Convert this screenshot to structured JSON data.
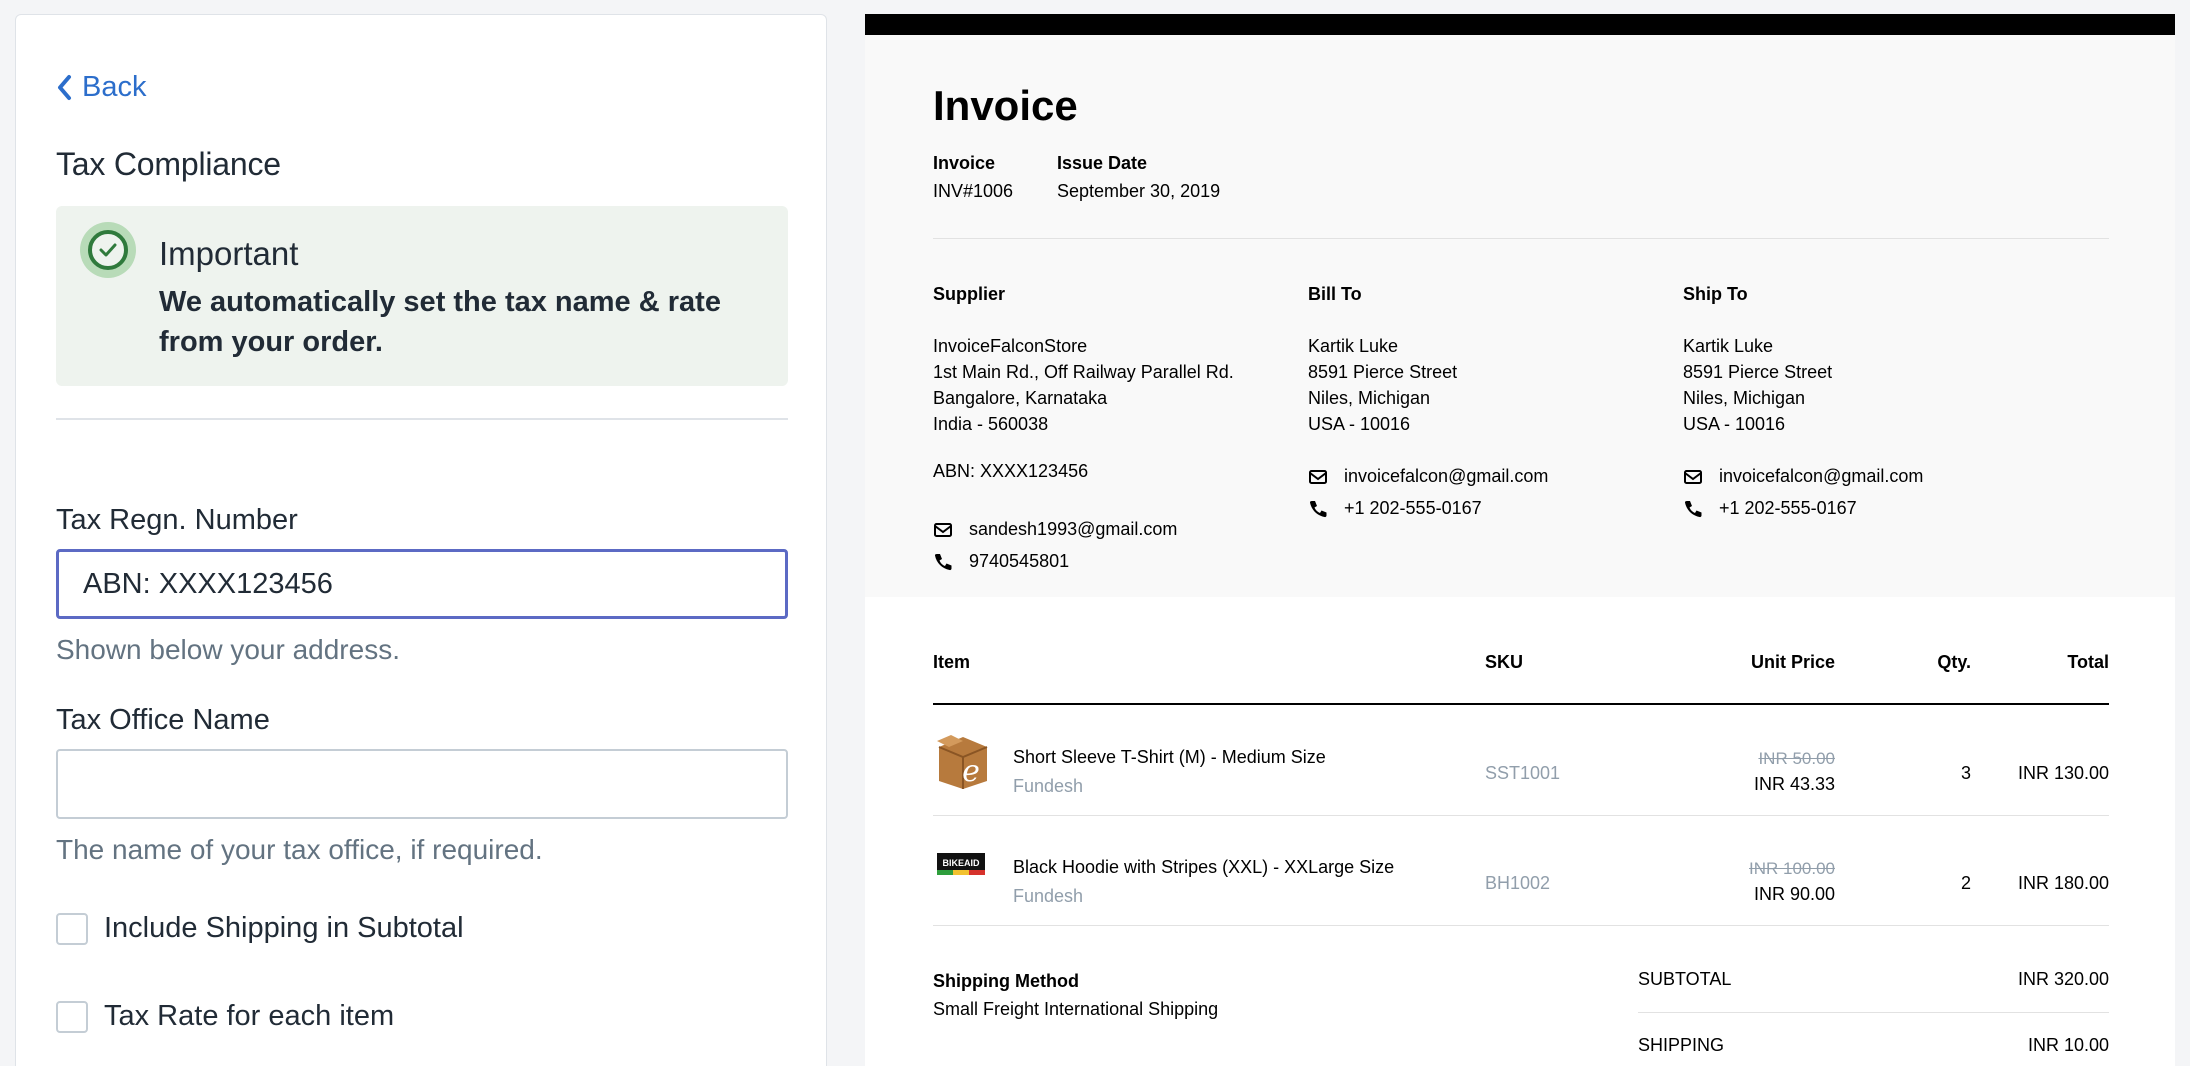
{
  "settings": {
    "back_label": "Back",
    "title": "Tax Compliance",
    "banner": {
      "heading": "Important",
      "body": "We automatically set the tax name & rate from your order."
    },
    "tax_regn": {
      "label": "Tax Regn. Number",
      "value": "ABN: XXXX123456",
      "help": "Shown below your address."
    },
    "tax_office": {
      "label": "Tax Office Name",
      "value": "",
      "help": "The name of your tax office, if required."
    },
    "checkboxes": [
      {
        "label": "Include Shipping in Subtotal",
        "checked": false
      },
      {
        "label": "Tax Rate for each item",
        "checked": false
      }
    ]
  },
  "invoice": {
    "title": "Invoice",
    "meta": {
      "invoice_label": "Invoice",
      "invoice_value": "INV#1006",
      "date_label": "Issue Date",
      "date_value": "September 30, 2019"
    },
    "supplier": {
      "label": "Supplier",
      "lines": [
        "InvoiceFalconStore",
        "1st Main Rd., Off Railway Parallel Rd.",
        "Bangalore, Karnataka",
        "India - 560038"
      ],
      "tax": "ABN: XXXX123456",
      "email": "sandesh1993@gmail.com",
      "phone": "9740545801"
    },
    "bill_to": {
      "label": "Bill To",
      "lines": [
        "Kartik Luke",
        "8591 Pierce Street",
        "Niles, Michigan",
        "USA - 10016"
      ],
      "email": "invoicefalcon@gmail.com",
      "phone": "+1 202-555-0167"
    },
    "ship_to": {
      "label": "Ship To",
      "lines": [
        "Kartik Luke",
        "8591 Pierce Street",
        "Niles, Michigan",
        "USA - 10016"
      ],
      "email": "invoicefalcon@gmail.com",
      "phone": "+1 202-555-0167"
    },
    "columns": {
      "item": "Item",
      "sku": "SKU",
      "unit_price": "Unit Price",
      "qty": "Qty.",
      "total": "Total"
    },
    "items": [
      {
        "name": "Short Sleeve T-Shirt (M) - Medium Size",
        "vendor": "Fundesh",
        "sku": "SST1001",
        "old_price": "INR 50.00",
        "price": "INR 43.33",
        "qty": "3",
        "total": "INR 130.00",
        "thumb_icon": "box-e-logo-icon"
      },
      {
        "name": "Black Hoodie with Stripes (XXL) - XXLarge Size",
        "vendor": "Fundesh",
        "sku": "BH1002",
        "old_price": "INR 100.00",
        "price": "INR 90.00",
        "qty": "2",
        "total": "INR 180.00",
        "thumb_icon": "bikeaid-logo-icon",
        "thumb_text": "BIKEAID"
      }
    ],
    "shipping": {
      "method_label": "Shipping Method",
      "method_value": "Small Freight International Shipping"
    },
    "summary": [
      {
        "label": "SUBTOTAL",
        "value": "INR 320.00"
      },
      {
        "label": "SHIPPING",
        "value": "INR 10.00"
      }
    ]
  }
}
